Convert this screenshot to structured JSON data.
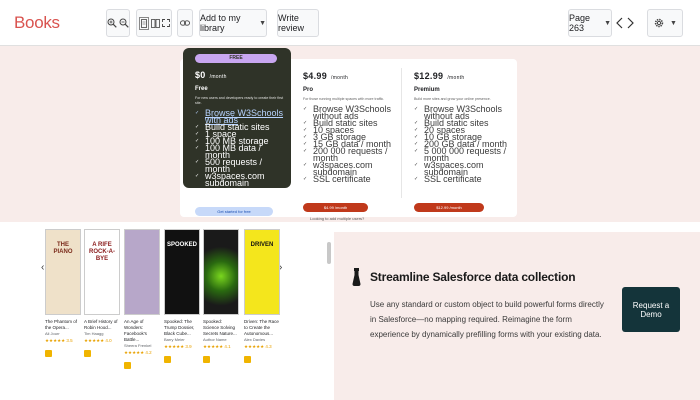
{
  "app": {
    "logo": "Books"
  },
  "toolbar": {
    "zoom_in_icon": "zoom-in-icon",
    "zoom_out_icon": "zoom-out-icon",
    "add_to_library": "Add to my library",
    "write_review": "Write review",
    "page_label": "Page 263"
  },
  "pricing": {
    "free": {
      "badge": "FREE",
      "price": "$0",
      "period": "/month",
      "name": "Free",
      "desc": "For new users and developers ready to create their first site.",
      "features": [
        "Browse W3Schools with ads",
        "Build static sites",
        "1 space",
        "100 MB storage",
        "100 MB data / month",
        "500 requests / month",
        "w3spaces.com subdomain"
      ],
      "cta": "Get started for free"
    },
    "pro": {
      "price": "$4.99",
      "period": "/month",
      "name": "Pro",
      "desc": "For those running multiple spaces with more traffic.",
      "features": [
        "Browse W3Schools without ads",
        "Build static sites",
        "10 spaces",
        "3 GB storage",
        "15 GB data / month",
        "200 000 requests / month",
        "w3spaces.com subdomain",
        "SSL certificate"
      ],
      "cta": "$4.99 /month"
    },
    "premium": {
      "price": "$12.99",
      "period": "/month",
      "name": "Premium",
      "desc": "Build more sites and grow your online presence.",
      "features": [
        "Browse W3Schools without ads",
        "Build static sites",
        "20 spaces",
        "10 GB storage",
        "200 GB data / month",
        "5 000 000 requests / month",
        "w3spaces.com subdomain",
        "SSL certificate"
      ],
      "cta": "$12.99 /month"
    },
    "note": "Looking to add multiple users?"
  },
  "books": [
    {
      "cover_text": "THE PIANO",
      "cover_bg": "#efe1c9",
      "cover_fg": "#7a2a1a",
      "title": "The Phantom of the Opera...",
      "author": "Ali Jourr",
      "stars": "★★★★★ 3.5"
    },
    {
      "cover_text": "A RIFE ROCK-A-BYE",
      "cover_bg": "#ffffff",
      "cover_fg": "#8a1a1a",
      "title": "A Brief History of Robin Hood...",
      "author": "Tim Haagg",
      "stars": "★★★★★ 4.0"
    },
    {
      "cover_text": "",
      "cover_bg": "#b7a7c9",
      "cover_fg": "#ffffff",
      "title": "An Age of Wonders: Facebook's Battle...",
      "author": "Sheera Frenkel",
      "stars": "★★★★★ 4.2"
    },
    {
      "cover_text": "SPOOKED",
      "cover_bg": "#111111",
      "cover_fg": "#ffffff",
      "title": "Spooked: The Trump Dossier, Black Cube...",
      "author": "Barry Meier",
      "stars": "★★★★★ 3.9"
    },
    {
      "cover_text": "",
      "cover_bg": "#1a1a1a",
      "cover_fg": "#ffffff",
      "title": "Spooked: Science Solving Secrets Nature...",
      "author": "Author Name",
      "stars": "★★★★★ 4.1"
    },
    {
      "cover_text": "DRIVEN",
      "cover_bg": "#f4e61c",
      "cover_fg": "#111111",
      "title": "Driven: The Race to Create the Autonomous...",
      "author": "Alex Davies",
      "stars": "★★★★★ 4.3"
    }
  ],
  "ad": {
    "title": "Streamline Salesforce data collection",
    "body": "Use any standard or custom object to build powerful forms directly in Salesforce—no mapping required. Reimagine the form experience by dynamically prefilling forms with your existing data.",
    "cta": "Request a Demo"
  }
}
